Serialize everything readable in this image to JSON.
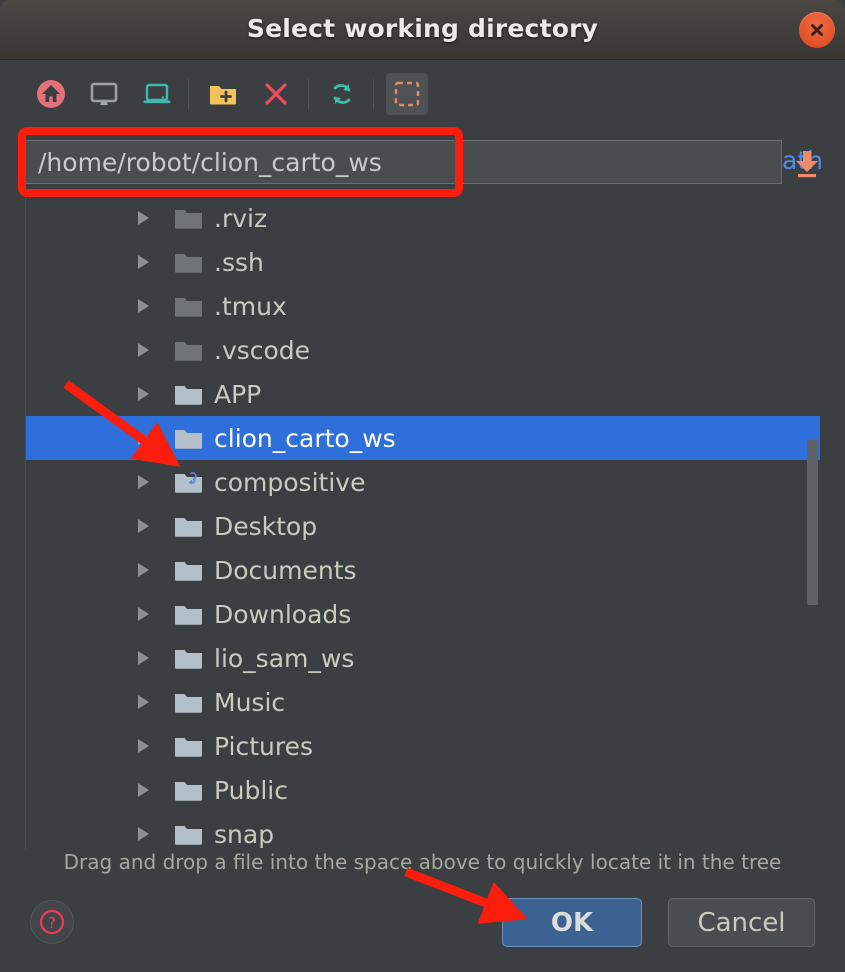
{
  "window": {
    "title": "Select working directory",
    "close_icon": "close-icon",
    "accent_blue": "#2f6fdb",
    "annotation_red": "#fc1d0c"
  },
  "toolbar": {
    "items": [
      {
        "name": "home-icon",
        "tooltip": "Home",
        "pressed": false
      },
      {
        "name": "desktop-icon",
        "tooltip": "Desktop",
        "pressed": false
      },
      {
        "name": "laptop-icon",
        "tooltip": "Computer",
        "pressed": false
      },
      {
        "name": "new-folder-icon",
        "tooltip": "New Folder",
        "pressed": false
      },
      {
        "name": "delete-icon",
        "tooltip": "Delete",
        "pressed": false
      },
      {
        "name": "refresh-icon",
        "tooltip": "Refresh",
        "pressed": false
      },
      {
        "name": "select-area-icon",
        "tooltip": "Show Hidden Files",
        "pressed": true
      }
    ],
    "hide_path_label": "Hide path"
  },
  "path": {
    "value": "/home/robot/clion_carto_ws",
    "placeholder": "",
    "dropdown_icon": "download-arrow-icon"
  },
  "tree": {
    "rows": [
      {
        "label": ".rviz",
        "hidden": true,
        "symlink": false,
        "selected": false,
        "expandable": true
      },
      {
        "label": ".ssh",
        "hidden": true,
        "symlink": false,
        "selected": false,
        "expandable": true
      },
      {
        "label": ".tmux",
        "hidden": true,
        "symlink": false,
        "selected": false,
        "expandable": true
      },
      {
        "label": ".vscode",
        "hidden": true,
        "symlink": false,
        "selected": false,
        "expandable": true
      },
      {
        "label": "APP",
        "hidden": false,
        "symlink": false,
        "selected": false,
        "expandable": true
      },
      {
        "label": "clion_carto_ws",
        "hidden": false,
        "symlink": false,
        "selected": true,
        "expandable": true
      },
      {
        "label": "compositive",
        "hidden": false,
        "symlink": true,
        "selected": false,
        "expandable": true
      },
      {
        "label": "Desktop",
        "hidden": false,
        "symlink": false,
        "selected": false,
        "expandable": true
      },
      {
        "label": "Documents",
        "hidden": false,
        "symlink": false,
        "selected": false,
        "expandable": true
      },
      {
        "label": "Downloads",
        "hidden": false,
        "symlink": false,
        "selected": false,
        "expandable": true
      },
      {
        "label": "lio_sam_ws",
        "hidden": false,
        "symlink": false,
        "selected": false,
        "expandable": true
      },
      {
        "label": "Music",
        "hidden": false,
        "symlink": false,
        "selected": false,
        "expandable": true
      },
      {
        "label": "Pictures",
        "hidden": false,
        "symlink": false,
        "selected": false,
        "expandable": true
      },
      {
        "label": "Public",
        "hidden": false,
        "symlink": false,
        "selected": false,
        "expandable": true
      },
      {
        "label": "snap",
        "hidden": false,
        "symlink": false,
        "selected": false,
        "expandable": true
      }
    ]
  },
  "footer": {
    "hint": "Drag and drop a file into the space above to quickly locate it in the tree",
    "help_icon": "help-icon",
    "ok_label": "OK",
    "cancel_label": "Cancel"
  }
}
